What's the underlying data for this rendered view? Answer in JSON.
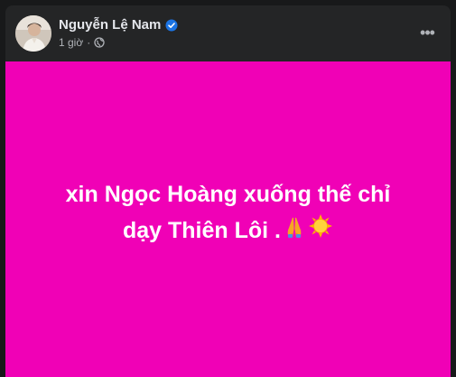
{
  "post": {
    "author": "Nguyễn Lệ Nam",
    "timestamp": "1 giờ",
    "separator": "·",
    "more_label": "•••",
    "text_line1": "xin Ngọc Hoàng xuống thế chỉ",
    "text_line2": "dạy Thiên Lôi .",
    "background_color": "#f001b6",
    "icons": [
      "verified-badge",
      "globe",
      "more-horizontal",
      "folded-hands-emoji",
      "sun-emoji"
    ]
  }
}
